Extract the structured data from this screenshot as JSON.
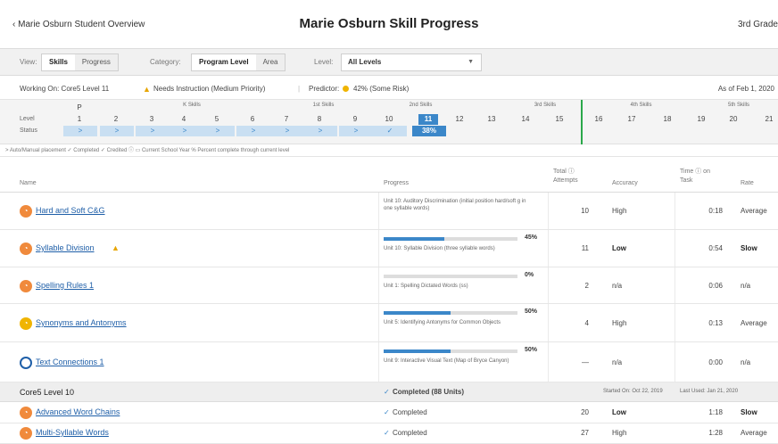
{
  "header": {
    "back_label": "‹ Marie Osburn Student Overview",
    "title": "Marie Osburn Skill Progress",
    "grade": "3rd Grade"
  },
  "controls": {
    "view_label": "View:",
    "view_options": [
      "Skills",
      "Progress"
    ],
    "view_selected": "Skills",
    "category_label": "Category:",
    "category_options": [
      "Program Level",
      "Area"
    ],
    "category_selected": "Program Level",
    "level_label": "Level:",
    "level_value": "All Levels"
  },
  "working": {
    "working_on": "Working On: Core5 Level 11",
    "needs": "Needs Instruction (Medium Priority)",
    "predictor_label": "Predictor:",
    "predictor_value": "42% (Some Risk)",
    "as_of": "As of Feb 1, 2020"
  },
  "level_strip": {
    "level_label": "Level",
    "status_label": "Status",
    "groups": [
      "K Skills",
      "1st Skills",
      "2nd Skills",
      "3rd Skills",
      "4th Skills",
      "5th Skills"
    ],
    "levels": [
      "P",
      "1",
      "2",
      "3",
      "4",
      "5",
      "6",
      "7",
      "8",
      "9",
      "10",
      "11",
      "12",
      "13",
      "14",
      "15",
      "16",
      "17",
      "18",
      "19",
      "20",
      "21"
    ],
    "current_level": "11",
    "current_percent": "38%",
    "status_symbol": ">",
    "check_symbol": "✓"
  },
  "legend": "> Auto/Manual placement ✓ Completed ✓ Credited ⓘ ▭ Current School Year % Percent complete through current level",
  "table_headers": {
    "name": "Name",
    "progress": "Progress",
    "total_attempts": "Total ⓘ Attempts",
    "accuracy": "Accuracy",
    "time_on_task": "Time ⓘ on Task",
    "rate": "Rate"
  },
  "rows": [
    {
      "name": "Hard and Soft C&G",
      "icon": "orange-skill-icon",
      "desc": "Unit 10: Auditory Discrimination (initial position hard/soft g in one syllable words)",
      "percent": "",
      "progress": 0,
      "attempts": "10",
      "accuracy": "High",
      "time": "0:18",
      "rate": "Average"
    },
    {
      "name": "Syllable Division",
      "icon": "orange-skill-icon",
      "warn": true,
      "desc": "Unit 10: Syllable Division (three syllable words)",
      "percent": "45%",
      "progress": 0.45,
      "attempts": "11",
      "accuracy": "Low",
      "time": "0:54",
      "rate": "Slow"
    },
    {
      "name": "Spelling Rules 1",
      "icon": "orange-skill-icon",
      "desc": "Unit 1: Spelling Dictated Words (ss)",
      "percent": "0%",
      "progress": 0,
      "attempts": "2",
      "accuracy": "n/a",
      "time": "0:06",
      "rate": "n/a"
    },
    {
      "name": "Synonyms and Antonyms",
      "icon": "yellow-skill-icon",
      "desc": "Unit 5: Identifying Antonyms for Common Objects",
      "percent": "50%",
      "progress": 0.5,
      "attempts": "4",
      "accuracy": "High",
      "time": "0:13",
      "rate": "Average"
    },
    {
      "name": "Text Connections 1",
      "icon": "blue-skill-icon",
      "desc": "Unit 9: Interactive Visual Text (Map of Bryce Canyon)",
      "percent": "50%",
      "progress": 0.5,
      "attempts": "—",
      "accuracy": "n/a",
      "time": "0:00",
      "rate": "n/a"
    }
  ],
  "group": {
    "name": "Core5 Level 10",
    "status": "Completed (88 Units)",
    "started": "Started On: Oct 22, 2019",
    "last_used": "Last Used: Jan 21, 2020"
  },
  "group_rows": [
    {
      "name": "Advanced Word Chains",
      "status": "Completed",
      "attempts": "20",
      "accuracy": "Low",
      "time": "1:18",
      "rate": "Slow"
    },
    {
      "name": "Multi-Syllable Words",
      "status": "Completed",
      "attempts": "27",
      "accuracy": "High",
      "time": "1:28",
      "rate": "Average"
    }
  ],
  "colors": {
    "accent": "#3b87c9",
    "green": "#2aa84a",
    "orange": "#f08a3c",
    "yellow": "#f0b400",
    "link": "#1f5fa8"
  }
}
